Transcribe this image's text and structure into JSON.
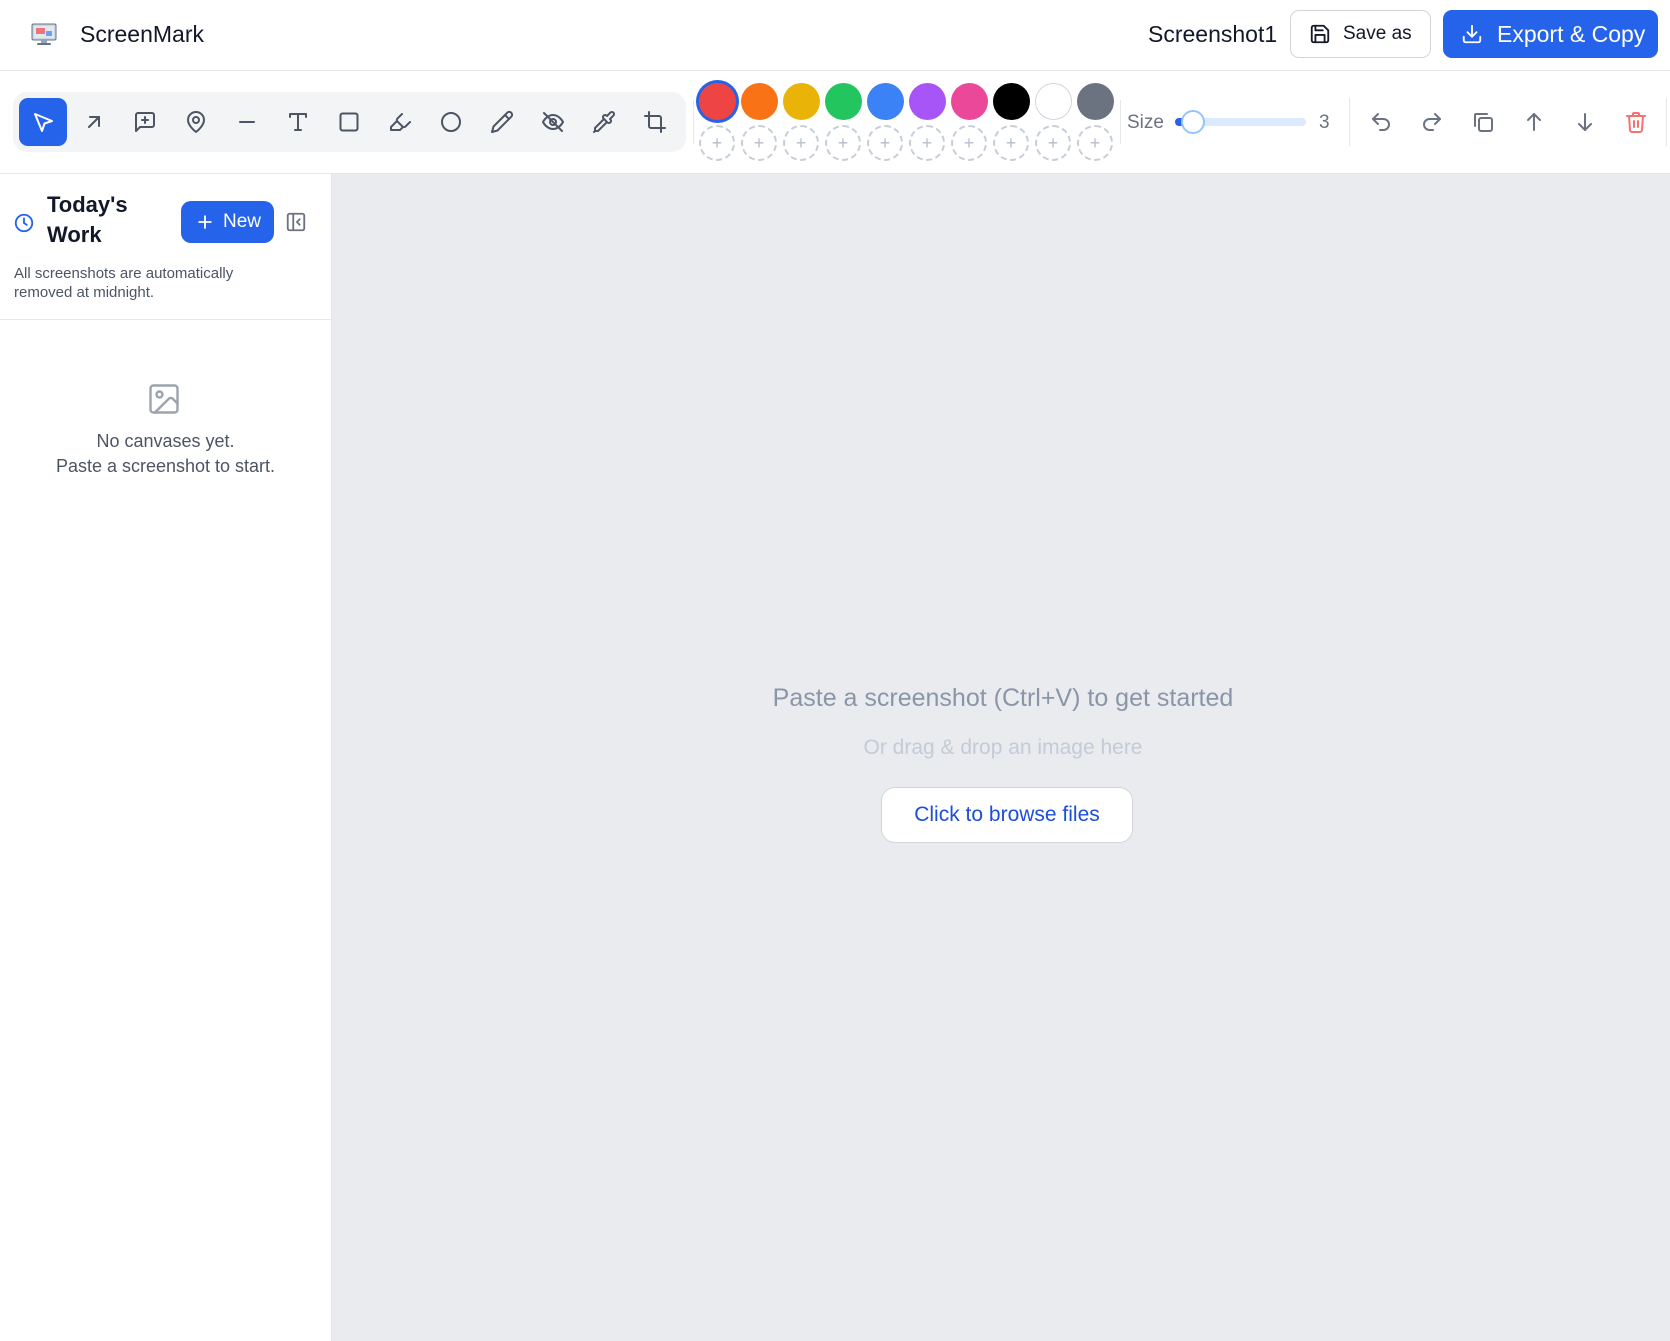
{
  "header": {
    "app_name": "ScreenMark",
    "app_icon": "monitor-screenshot-icon",
    "document_title": "Screenshot1",
    "save_as_label": "Save as",
    "export_label": "Export & Copy"
  },
  "toolbar": {
    "tools": [
      {
        "name": "select",
        "icon": "cursor-icon",
        "active": true
      },
      {
        "name": "arrow",
        "icon": "arrow-up-right-icon",
        "active": false
      },
      {
        "name": "callout",
        "icon": "message-plus-icon",
        "active": false
      },
      {
        "name": "pin",
        "icon": "map-pin-icon",
        "active": false
      },
      {
        "name": "line",
        "icon": "minus-icon",
        "active": false
      },
      {
        "name": "text",
        "icon": "type-icon",
        "active": false
      },
      {
        "name": "rectangle",
        "icon": "square-icon",
        "active": false
      },
      {
        "name": "highlighter",
        "icon": "highlighter-icon",
        "active": false
      },
      {
        "name": "ellipse",
        "icon": "circle-icon",
        "active": false
      },
      {
        "name": "pencil",
        "icon": "pencil-icon",
        "active": false
      },
      {
        "name": "blur",
        "icon": "eye-off-icon",
        "active": false
      },
      {
        "name": "eyedropper",
        "icon": "pipette-icon",
        "active": false
      },
      {
        "name": "crop",
        "icon": "crop-icon",
        "active": false
      }
    ],
    "colors": [
      "#ef4444",
      "#f97316",
      "#eab308",
      "#22c55e",
      "#3b82f6",
      "#a855f7",
      "#ec4899",
      "#000000",
      "#ffffff",
      "#6b7280"
    ],
    "selected_color": "#ef4444",
    "custom_color_slots": 10,
    "size_label": "Size",
    "size_value": "3",
    "size_fraction": 0.05,
    "actions": [
      "undo-icon",
      "redo-icon",
      "duplicate-icon",
      "bring-forward-icon",
      "send-backward-icon",
      "delete-icon"
    ]
  },
  "sidebar": {
    "title": "Today's Work",
    "new_label": "New",
    "note": "All screenshots are automatically removed at midnight.",
    "empty_line1": "No canvases yet.",
    "empty_line2": "Paste a screenshot to start."
  },
  "canvas": {
    "paste_hint": "Paste a screenshot (Ctrl+V) to get started",
    "drag_hint": "Or drag & drop an image here",
    "browse_label": "Click to browse files"
  },
  "theme": {
    "accent": "#2563eb",
    "delete": "#ef4444"
  }
}
